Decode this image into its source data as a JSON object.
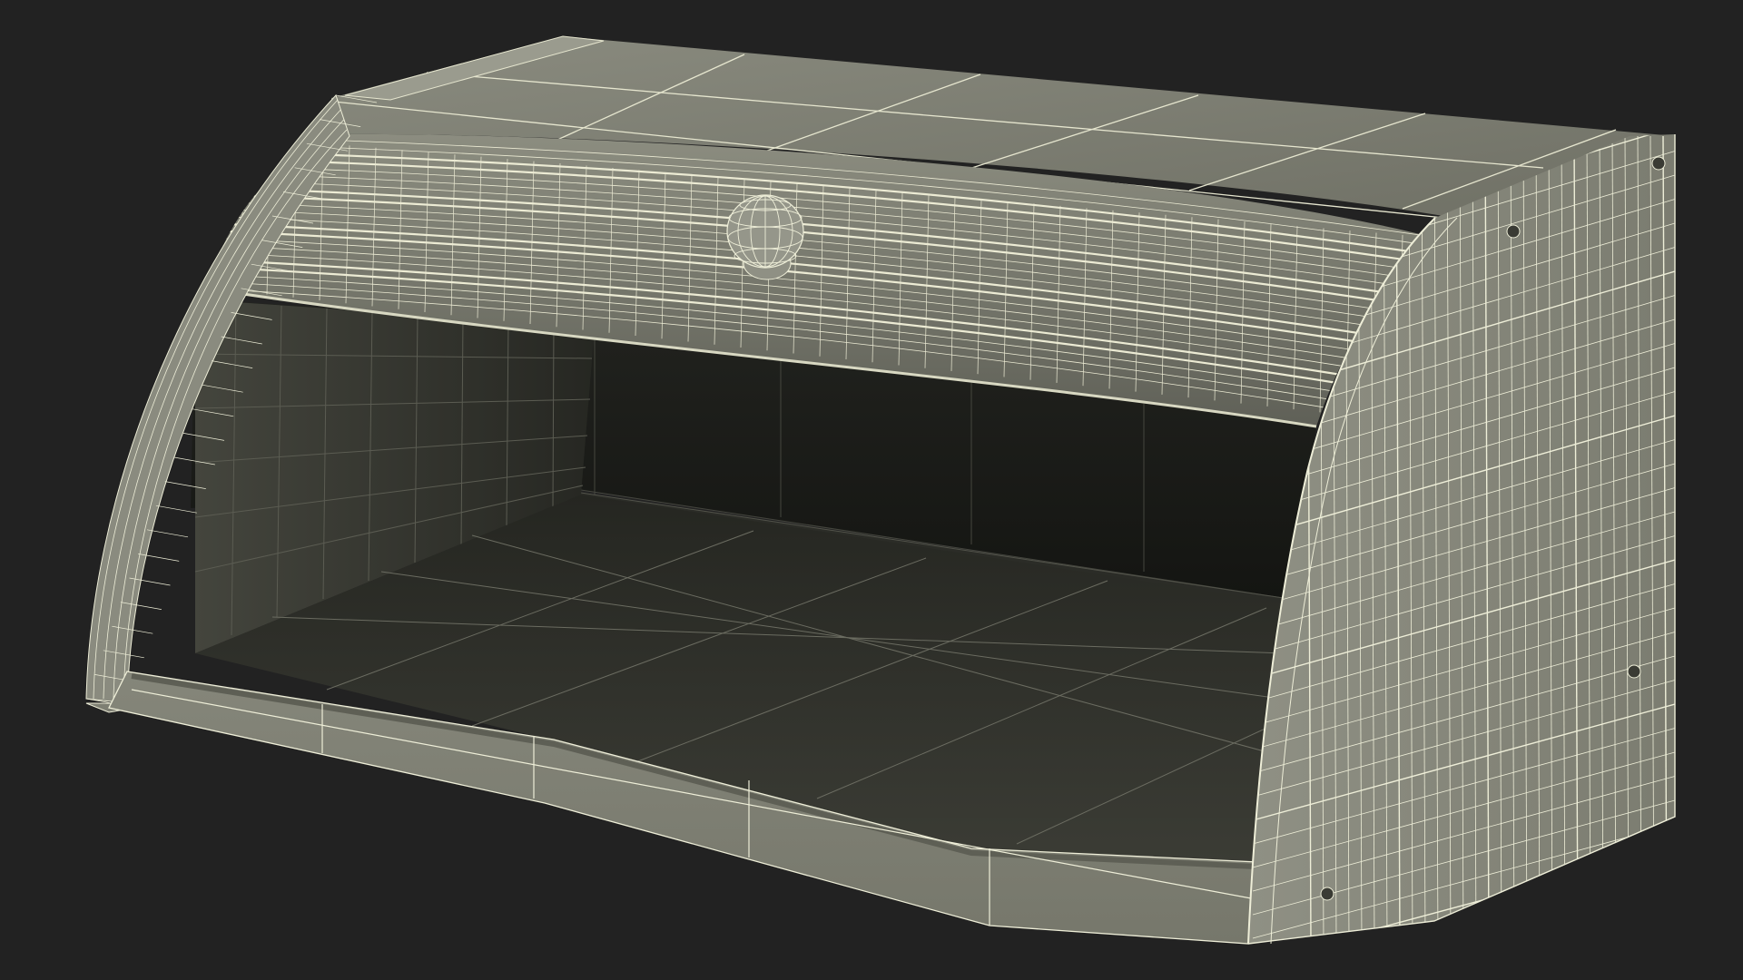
{
  "scene": {
    "subject": "bread-box-wireframe-render",
    "background_color": "#222222",
    "surface_color": "#7d7e72",
    "wire_color": "#eeeed8",
    "interior_color": "#1d1e1a"
  }
}
